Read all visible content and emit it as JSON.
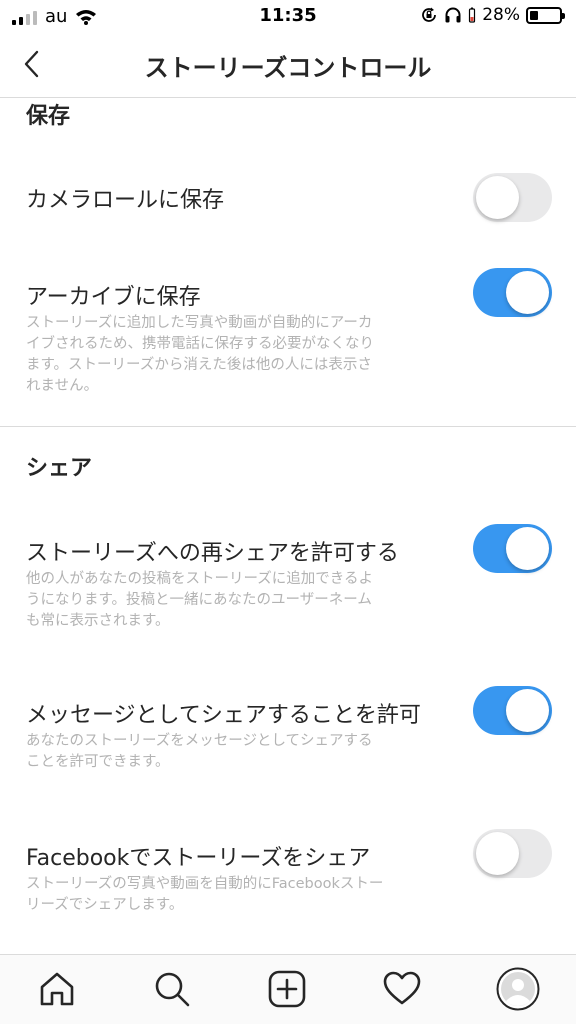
{
  "status_bar": {
    "carrier": "au",
    "time": "11:35",
    "battery_percent": "28%",
    "battery_level": 0.28,
    "icons": [
      "signal-icon",
      "wifi-icon",
      "rotation-lock-icon",
      "headphones-icon",
      "battery-icon"
    ]
  },
  "nav": {
    "title": "ストーリーズコントロール",
    "back_icon": "chevron-left-icon"
  },
  "sections": {
    "save": {
      "header": "保存",
      "camera_roll": {
        "label": "カメラロールに保存",
        "enabled": false
      },
      "archive": {
        "label": "アーカイブに保存",
        "description_lines": [
          "ストーリーズに追加した写真や動画が自動的にアーカ",
          "イブされるため、携帯電話に保存する必要がなくなり",
          "ます。ストーリーズから消えた後は他の人には表示さ",
          "れません。"
        ],
        "enabled": true
      }
    },
    "share": {
      "header": "シェア",
      "reshare": {
        "label": "ストーリーズへの再シェアを許可する",
        "description_lines": [
          "他の人があなたの投稿をストーリーズに追加できるよ",
          "うになります。投稿と一緒にあなたのユーザーネーム",
          "も常に表示されます。"
        ],
        "enabled": true
      },
      "message_share": {
        "label": "メッセージとしてシェアすることを許可",
        "description_lines": [
          "あなたのストーリーズをメッセージとしてシェアする",
          "ことを許可できます。"
        ],
        "enabled": true
      },
      "facebook_share": {
        "label": "Facebookでストーリーズをシェア",
        "description_lines": [
          "ストーリーズの写真や動画を自動的にFacebookストー",
          "リーズでシェアします。"
        ],
        "enabled": false
      }
    }
  },
  "tab_bar": {
    "tabs": [
      "home-icon",
      "search-icon",
      "new-post-icon",
      "activity-heart-icon",
      "profile-avatar"
    ]
  },
  "colors": {
    "toggle_on": "#3897f0",
    "toggle_off": "#e9e9ea",
    "text_primary": "#262626",
    "text_secondary": "#b3b3b3",
    "divider": "#dbdbdb"
  }
}
